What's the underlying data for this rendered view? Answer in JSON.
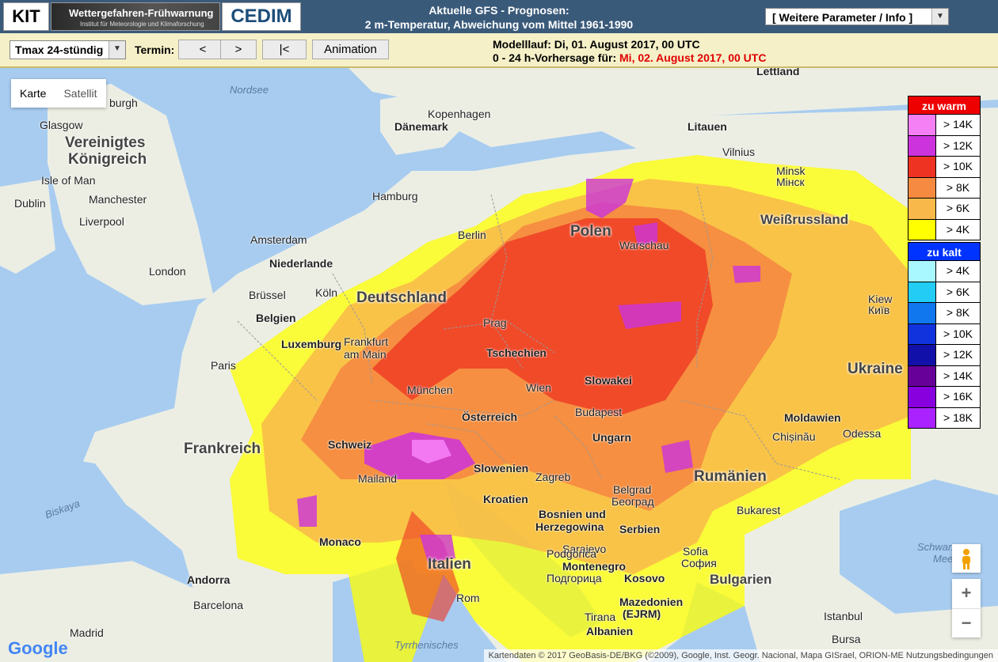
{
  "header": {
    "logo_kit": "KIT",
    "logo_wf_title": "Wettergefahren-Frühwarnung",
    "logo_wf_sub": "Institut für Meteorologie und Klimaforschung",
    "logo_cedim": "CEDIM",
    "title_line1": "Aktuelle GFS - Prognosen:",
    "title_line2": "2 m-Temperatur, Abweichung vom Mittel 1961-1990",
    "param_select": "[ Weitere Parameter / Info ]"
  },
  "toolbar": {
    "variable_select": "Tmax 24-stündig",
    "termin_label": "Termin:",
    "btn_prev": "<",
    "btn_next": ">",
    "btn_first": "|<",
    "btn_animation": "Animation",
    "modelllauf": "Modelllauf: Di, 01. August 2017, 00 UTC",
    "vorhersage_prefix": "0 - 24 h-Vorhersage für: ",
    "vorhersage_date": "Mi, 02. August 2017, 00 UTC"
  },
  "map_controls": {
    "karte": "Karte",
    "satellit": "Satellit",
    "zoom_in": "+",
    "zoom_out": "−",
    "google": "Google",
    "attribution": "Kartendaten © 2017 GeoBasis-DE/BKG (©2009), Google, Inst. Geogr. Nacional, Mapa GISrael, ORION-ME   Nutzungsbedingungen"
  },
  "legend": {
    "warm_title": "zu warm",
    "warm": [
      {
        "label": "> 14K",
        "color": "#f57ff5"
      },
      {
        "label": "> 12K",
        "color": "#cc33dd"
      },
      {
        "label": "> 10K",
        "color": "#ee3322"
      },
      {
        "label": "> 8K",
        "color": "#f58a40"
      },
      {
        "label": "> 6K",
        "color": "#f8b84a"
      },
      {
        "label": "> 4K",
        "color": "#ffff00"
      }
    ],
    "cold_title": "zu kalt",
    "cold": [
      {
        "label": "> 4K",
        "color": "#aaf8ff"
      },
      {
        "label": "> 6K",
        "color": "#22ccf5"
      },
      {
        "label": "> 8K",
        "color": "#1177ee"
      },
      {
        "label": "> 10K",
        "color": "#1133dd"
      },
      {
        "label": "> 12K",
        "color": "#1111aa"
      },
      {
        "label": "> 14K",
        "color": "#660099"
      },
      {
        "label": "> 16K",
        "color": "#8800dd"
      },
      {
        "label": "> 18K",
        "color": "#aa22ff"
      }
    ]
  },
  "labels": {
    "countries": {
      "vk": "Vereinigtes",
      "vk2": "Königreich",
      "daenemark": "Dänemark",
      "litauen": "Litauen",
      "lettland": "Lettland",
      "polen": "Polen",
      "weissrussland": "Weißrussland",
      "niederlande": "Niederlande",
      "deutschland": "Deutschland",
      "belgien": "Belgien",
      "luxemburg": "Luxemburg",
      "tschechien": "Tschechien",
      "slowakei": "Slowakei",
      "ukraine": "Ukraine",
      "oesterreich": "Österreich",
      "schweiz": "Schweiz",
      "frankreich": "Frankreich",
      "slowenien": "Slowenien",
      "kroatien": "Kroatien",
      "ungarn": "Ungarn",
      "moldawien": "Moldawien",
      "rumaenien": "Rumänien",
      "bosnien": "Bosnien und",
      "herzegowina": "Herzegowina",
      "serbien": "Serbien",
      "montenegro": "Montenegro",
      "kosovo": "Kosovo",
      "bulgarien": "Bulgarien",
      "italien": "Italien",
      "albanien": "Albanien",
      "mazedonien": "Mazedonien",
      "ejrm": "(EJRM)",
      "andorra": "Andorra",
      "monaco": "Monaco"
    },
    "cities": {
      "glasgow": "Glasgow",
      "burgh": "burgh",
      "isle_of_man": "Isle of Man",
      "dublin": "Dublin",
      "manchester": "Manchester",
      "liverpool": "Liverpool",
      "london": "London",
      "kopenhagen": "Kopenhagen",
      "hamburg": "Hamburg",
      "amsterdam": "Amsterdam",
      "berlin": "Berlin",
      "warschau": "Warschau",
      "vilnius": "Vilnius",
      "minsk": "Minsk",
      "minsk_cyr": "Мінск",
      "bruessel": "Brüssel",
      "koeln": "Köln",
      "frankfurt1": "Frankfurt",
      "frankfurt2": "am Main",
      "prag": "Prag",
      "kiew": "Kiew",
      "kiew_cyr": "Київ",
      "paris": "Paris",
      "muenchen": "München",
      "wien": "Wien",
      "budapest": "Budapest",
      "chisinau": "Chișinău",
      "odessa": "Odessa",
      "mailand": "Mailand",
      "zagreb": "Zagreb",
      "belgrad": "Belgrad",
      "belgrad_cyr": "Београд",
      "bukarest": "Bukarest",
      "sarajevo": "Sarajevo",
      "podgorica": "Podgorica",
      "podgorica_cyr": "Подгорица",
      "sofia": "Sofia",
      "sofia_cyr": "София",
      "barcelona": "Barcelona",
      "madrid": "Madrid",
      "rom": "Rom",
      "tirana": "Tirana",
      "istanbul": "Istanbul",
      "bursa": "Bursa",
      "lettland_nordsee": "Nordsee",
      "biskaya": "Biskaya",
      "tyrrhenisches": "Tyrrhenisches",
      "schwarzes1": "Schwarzes",
      "schwarzes2": "Meer"
    }
  }
}
